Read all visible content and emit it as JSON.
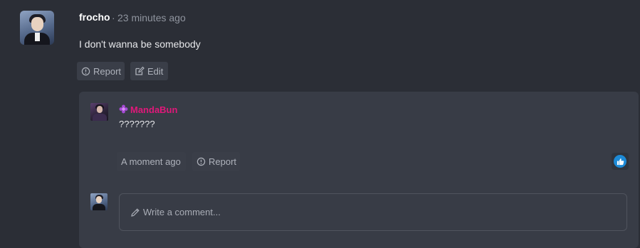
{
  "post": {
    "author": "frocho",
    "separator": "·",
    "time": "23 minutes ago",
    "text": "I don't wanna be somebody",
    "actions": {
      "report": "Report",
      "edit": "Edit"
    }
  },
  "reply": {
    "author": "MandaBun",
    "author_color": "#e0187a",
    "badge_icon": "flower-badge-icon",
    "text": "???????",
    "time": "A moment ago",
    "report": "Report",
    "like_icon": "thumbs-up-icon",
    "like_color": "#1d8ad6"
  },
  "composer": {
    "placeholder": "Write a comment..."
  },
  "colors": {
    "background": "#2b2e36",
    "card": "#383c46",
    "button": "#3a3e48"
  }
}
